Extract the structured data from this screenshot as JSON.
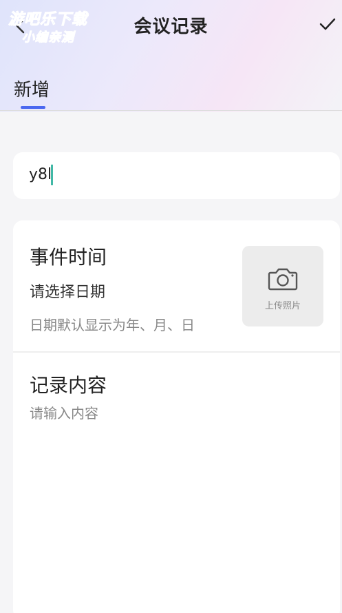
{
  "watermark": {
    "line1": "游吧乐下载",
    "line2": "小编亲测"
  },
  "header": {
    "title": "会议记录",
    "back_icon": "chevron-left-icon",
    "confirm_icon": "check-icon"
  },
  "tabs": [
    {
      "label": "新增",
      "active": true
    }
  ],
  "title_field": {
    "value": "y8l"
  },
  "event": {
    "label": "事件时间",
    "date_placeholder": "请选择日期",
    "date_hint": "日期默认显示为年、月、日"
  },
  "upload": {
    "label": "上传照片",
    "icon": "camera-icon"
  },
  "content": {
    "label": "记录内容",
    "placeholder": "请输入内容"
  },
  "colors": {
    "accent": "#4a67f0",
    "caret": "#41b8a6",
    "card": "#ffffff",
    "background": "#f5f5f7"
  }
}
